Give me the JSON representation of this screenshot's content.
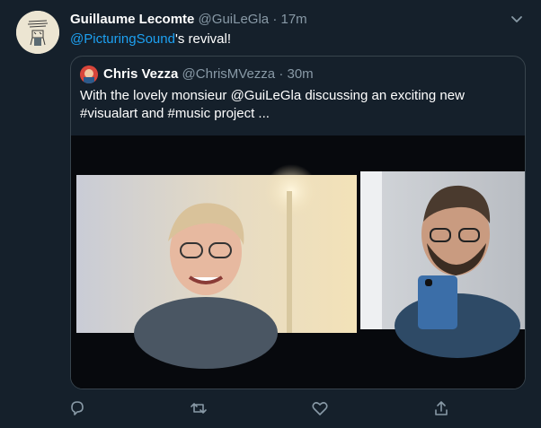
{
  "tweet": {
    "author_name": "Guillaume Lecomte",
    "author_handle": "@GuiLeGla",
    "separator": "·",
    "time": "17m",
    "text_mention": "@PicturingSound",
    "text_rest": "'s revival!"
  },
  "quoted": {
    "author_name": "Chris Vezza",
    "author_handle": "@ChrisMVezza",
    "separator": "·",
    "time": "30m",
    "text_line1": "With the lovely monsieur @GuiLeGla discussing an exciting new",
    "text_line2": "#visualart and #music project ..."
  },
  "actions": {
    "reply_icon": "reply-icon",
    "retweet_icon": "retweet-icon",
    "like_icon": "heart-icon",
    "share_icon": "share-icon"
  },
  "colors": {
    "background": "#15202b",
    "accent": "#1da1f2",
    "muted": "#8899a6",
    "border": "#38444d"
  }
}
